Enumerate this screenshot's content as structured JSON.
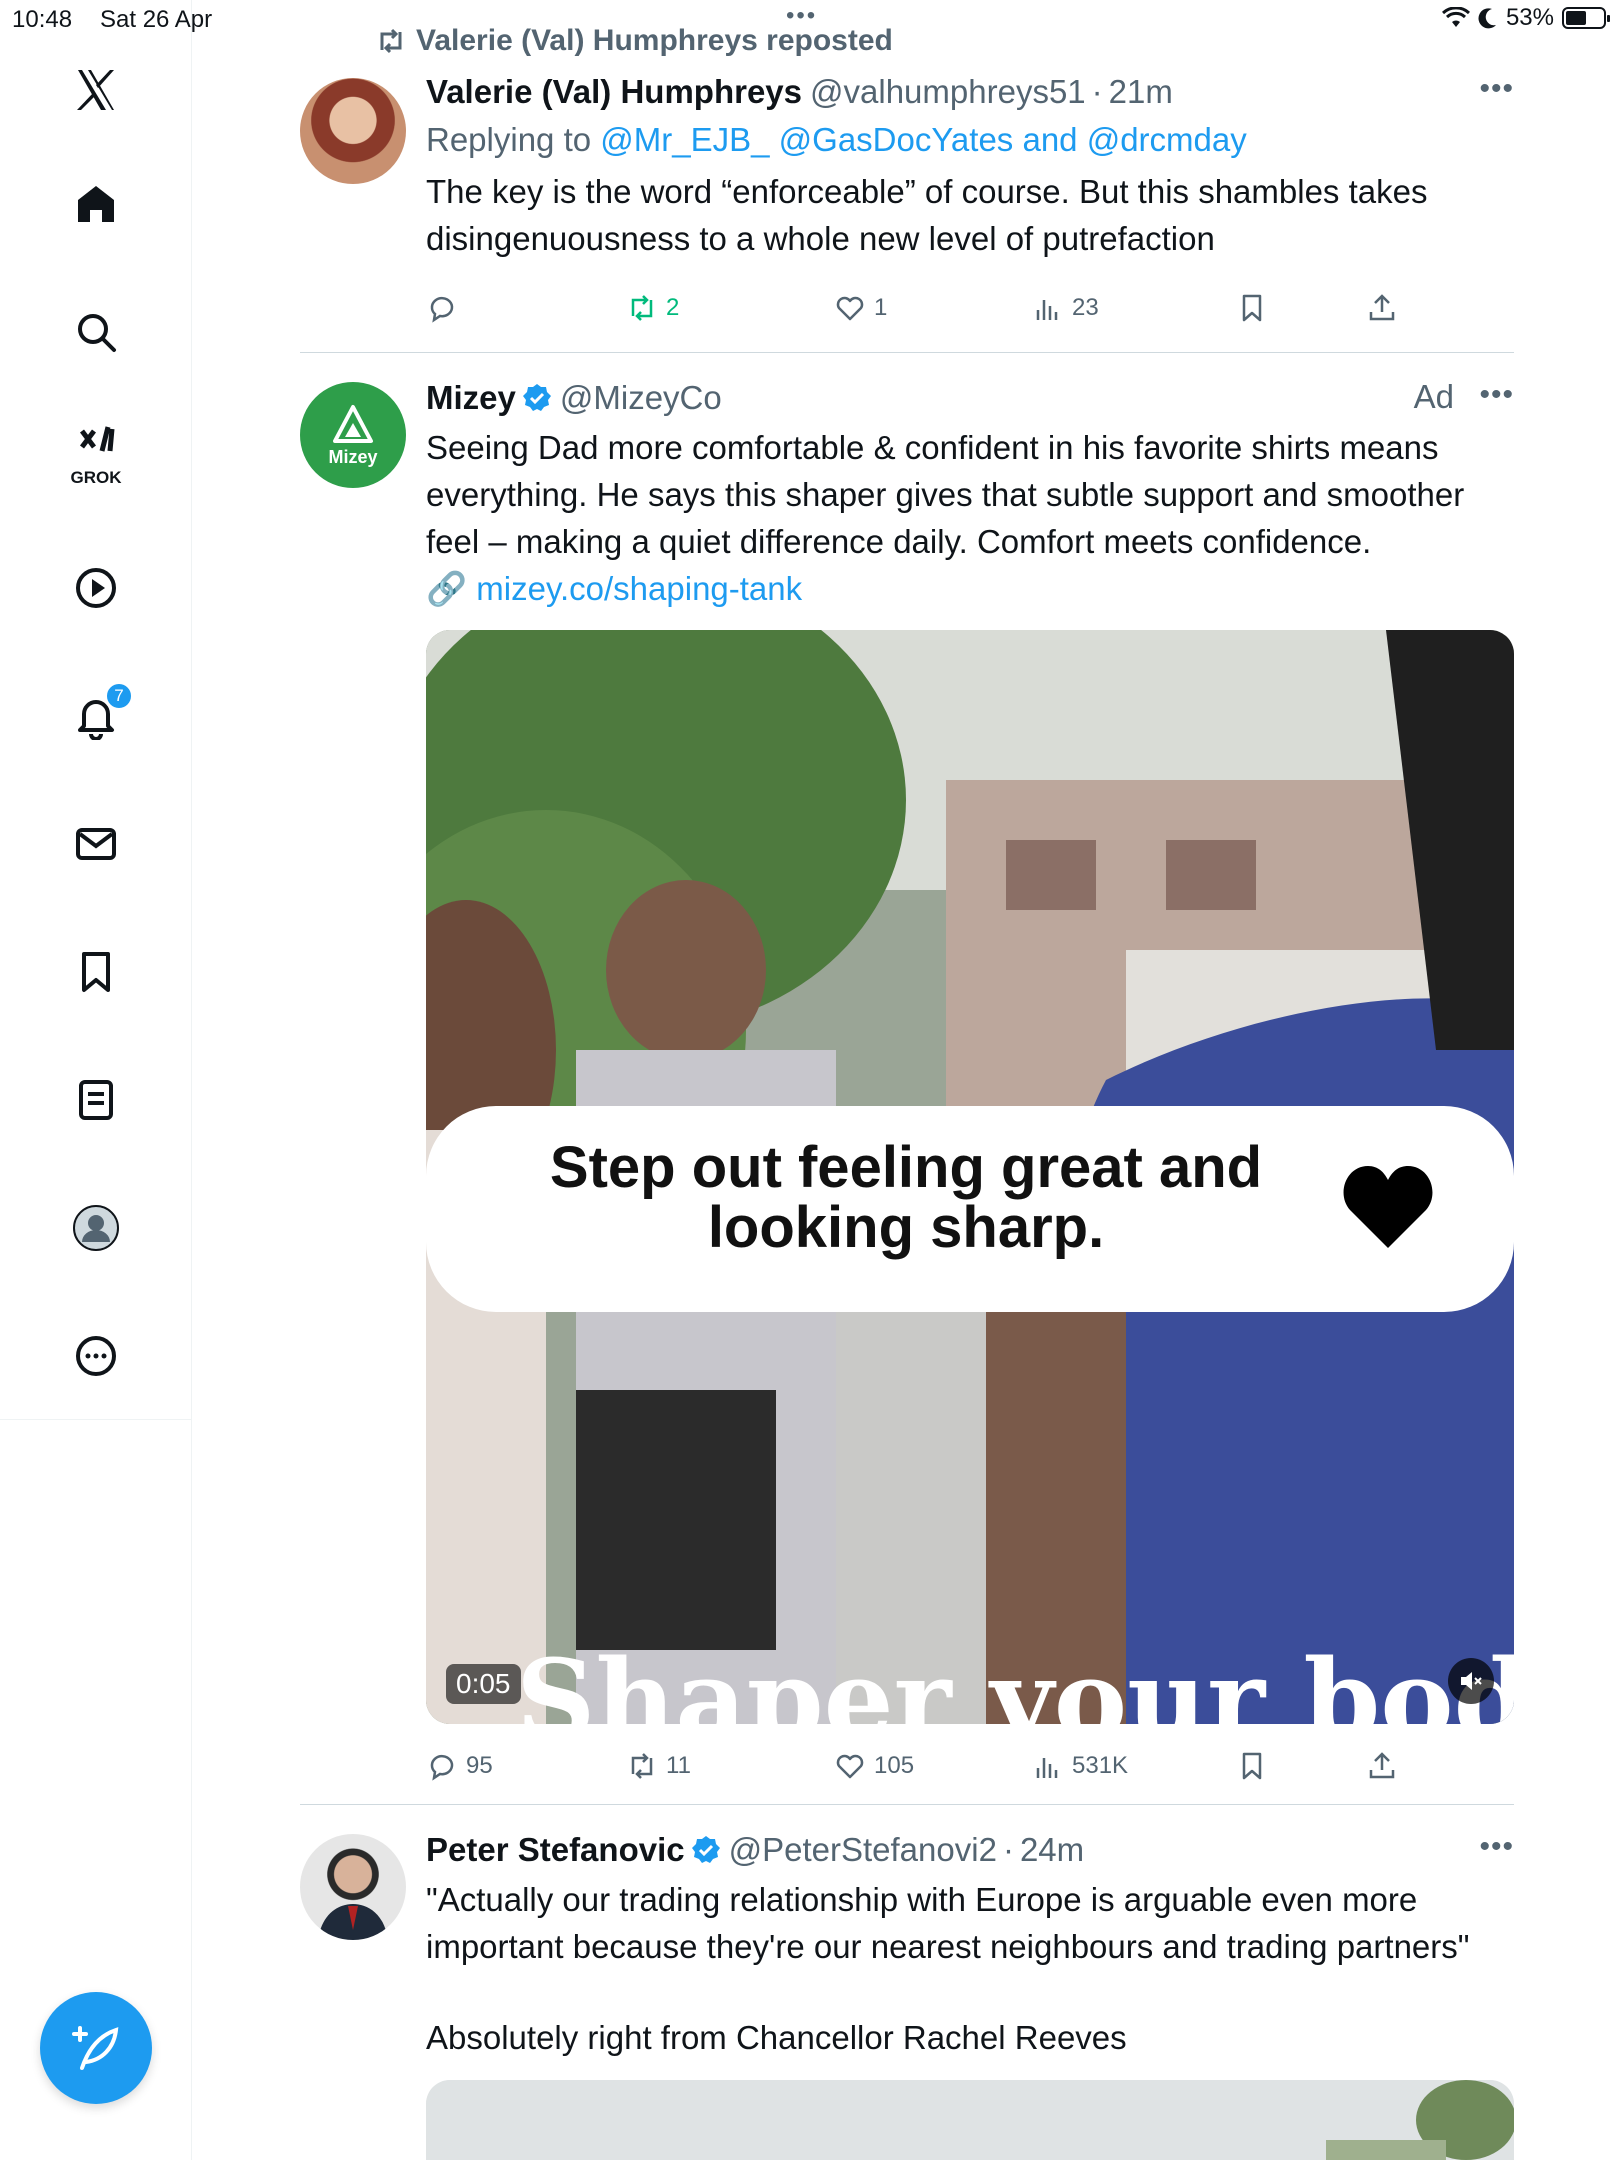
{
  "status_bar": {
    "time": "10:48",
    "date": "Sat 26 Apr",
    "battery": "53%"
  },
  "sidebar": {
    "grok_label": "GROK",
    "notifications_badge": "7"
  },
  "feed": {
    "repost_line": "Valerie (Val) Humphreys reposted",
    "tweets": [
      {
        "name": "Valerie (Val) Humphreys",
        "handle": "@valhumphreys51",
        "time": "21m",
        "replying_prefix": "Replying to",
        "replying_to": "@Mr_EJB_ @GasDocYates and @drcmday",
        "text_line1": "The key is the word “enforceable” of course. But this shambles takes",
        "text_line2": "disingenuousness to a whole new level of putrefaction",
        "retweets": "2",
        "likes": "1",
        "views": "23"
      },
      {
        "name": "Mizey",
        "handle": "@MizeyCo",
        "avatar_label": "Mizey",
        "ad": "Ad",
        "text_line1": "Seeing Dad more comfortable & confident in his favorite shirts means",
        "text_line2": "everything. He says this shaper gives that subtle support and smoother",
        "text_line3": "feel – making a quiet difference daily. Comfort meets confidence.",
        "link_icon": "🔗",
        "link": "mizey.co/shaping-tank",
        "video_caption_line1": "Step out feeling great and",
        "video_caption_line2": "looking sharp.",
        "video_overlay_text": "Shaper your body",
        "video_duration": "0:05",
        "replies": "95",
        "retweets": "11",
        "likes": "105",
        "views": "531K"
      },
      {
        "name": "Peter Stefanovic",
        "handle": "@PeterStefanovi2",
        "time": "24m",
        "text_line1": "\"Actually our trading relationship with Europe is arguable even more",
        "text_line2": "important because they're our nearest neighbours and trading partners\"",
        "text_line3": "Absolutely right from Chancellor Rachel Reeves"
      }
    ]
  },
  "colors": {
    "accent": "#1d9bf0",
    "retweet_green": "#00ba7c",
    "muted": "#536471",
    "mizey_green": "#2e9e4a"
  }
}
